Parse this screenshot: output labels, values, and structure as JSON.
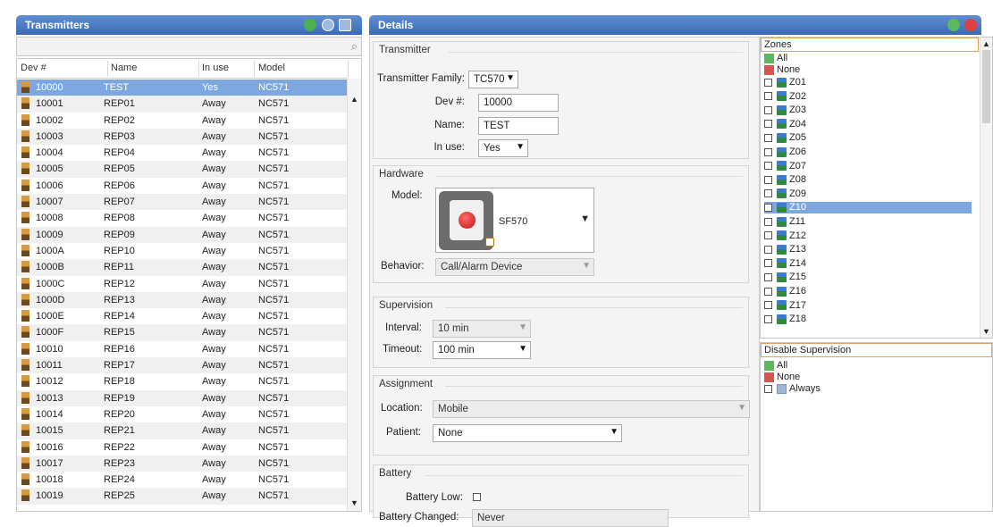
{
  "left_panel": {
    "title": "Transmitters",
    "columns": [
      "Dev #",
      "Name",
      "In use",
      "Model"
    ],
    "rows": [
      {
        "dev": "10000",
        "name": "TEST",
        "in_use": "Yes",
        "model": "NC571",
        "selected": true
      },
      {
        "dev": "10001",
        "name": "REP01",
        "in_use": "Away",
        "model": "NC571"
      },
      {
        "dev": "10002",
        "name": "REP02",
        "in_use": "Away",
        "model": "NC571"
      },
      {
        "dev": "10003",
        "name": "REP03",
        "in_use": "Away",
        "model": "NC571"
      },
      {
        "dev": "10004",
        "name": "REP04",
        "in_use": "Away",
        "model": "NC571"
      },
      {
        "dev": "10005",
        "name": "REP05",
        "in_use": "Away",
        "model": "NC571"
      },
      {
        "dev": "10006",
        "name": "REP06",
        "in_use": "Away",
        "model": "NC571"
      },
      {
        "dev": "10007",
        "name": "REP07",
        "in_use": "Away",
        "model": "NC571"
      },
      {
        "dev": "10008",
        "name": "REP08",
        "in_use": "Away",
        "model": "NC571"
      },
      {
        "dev": "10009",
        "name": "REP09",
        "in_use": "Away",
        "model": "NC571"
      },
      {
        "dev": "1000A",
        "name": "REP10",
        "in_use": "Away",
        "model": "NC571"
      },
      {
        "dev": "1000B",
        "name": "REP11",
        "in_use": "Away",
        "model": "NC571"
      },
      {
        "dev": "1000C",
        "name": "REP12",
        "in_use": "Away",
        "model": "NC571"
      },
      {
        "dev": "1000D",
        "name": "REP13",
        "in_use": "Away",
        "model": "NC571"
      },
      {
        "dev": "1000E",
        "name": "REP14",
        "in_use": "Away",
        "model": "NC571"
      },
      {
        "dev": "1000F",
        "name": "REP15",
        "in_use": "Away",
        "model": "NC571"
      },
      {
        "dev": "10010",
        "name": "REP16",
        "in_use": "Away",
        "model": "NC571"
      },
      {
        "dev": "10011",
        "name": "REP17",
        "in_use": "Away",
        "model": "NC571"
      },
      {
        "dev": "10012",
        "name": "REP18",
        "in_use": "Away",
        "model": "NC571"
      },
      {
        "dev": "10013",
        "name": "REP19",
        "in_use": "Away",
        "model": "NC571"
      },
      {
        "dev": "10014",
        "name": "REP20",
        "in_use": "Away",
        "model": "NC571"
      },
      {
        "dev": "10015",
        "name": "REP21",
        "in_use": "Away",
        "model": "NC571"
      },
      {
        "dev": "10016",
        "name": "REP22",
        "in_use": "Away",
        "model": "NC571"
      },
      {
        "dev": "10017",
        "name": "REP23",
        "in_use": "Away",
        "model": "NC571"
      },
      {
        "dev": "10018",
        "name": "REP24",
        "in_use": "Away",
        "model": "NC571"
      },
      {
        "dev": "10019",
        "name": "REP25",
        "in_use": "Away",
        "model": "NC571"
      }
    ],
    "header_icons": [
      "add-icon",
      "copy-icon",
      "delete-icon"
    ],
    "search_icon": "search-icon"
  },
  "details": {
    "title": "Details",
    "header_icons": [
      "confirm-icon",
      "cancel-icon"
    ],
    "transmitter": {
      "group_title": "Transmitter",
      "family_label": "Transmitter Family:",
      "family_value": "TC570",
      "dev_label": "Dev #:",
      "dev_value": "10000",
      "name_label": "Name:",
      "name_value": "TEST",
      "in_use_label": "In use:",
      "in_use_value": "Yes"
    },
    "hardware": {
      "group_title": "Hardware",
      "model_label": "Model:",
      "model_value": "SF570",
      "behavior_label": "Behavior:",
      "behavior_value": "Call/Alarm Device"
    },
    "supervision": {
      "group_title": "Supervision",
      "interval_label": "Interval:",
      "interval_value": "10 min",
      "timeout_label": "Timeout:",
      "timeout_value": "100 min"
    },
    "assignment": {
      "group_title": "Assignment",
      "location_label": "Location:",
      "location_value": "Mobile",
      "patient_label": "Patient:",
      "patient_value": "None"
    },
    "battery": {
      "group_title": "Battery",
      "low_label": "Battery Low:",
      "changed_label": "Battery Changed:",
      "changed_value": "Never"
    }
  },
  "zones": {
    "title": "Zones",
    "all_label": "All",
    "none_label": "None",
    "items": [
      {
        "label": "Z01",
        "checked": false
      },
      {
        "label": "Z02",
        "checked": false
      },
      {
        "label": "Z03",
        "checked": false
      },
      {
        "label": "Z04",
        "checked": false
      },
      {
        "label": "Z05",
        "checked": false
      },
      {
        "label": "Z06",
        "checked": false
      },
      {
        "label": "Z07",
        "checked": false
      },
      {
        "label": "Z08",
        "checked": false
      },
      {
        "label": "Z09",
        "checked": false
      },
      {
        "label": "Z10",
        "checked": true,
        "selected": true
      },
      {
        "label": "Z11",
        "checked": false
      },
      {
        "label": "Z12",
        "checked": false
      },
      {
        "label": "Z13",
        "checked": false
      },
      {
        "label": "Z14",
        "checked": false
      },
      {
        "label": "Z15",
        "checked": false
      },
      {
        "label": "Z16",
        "checked": false
      },
      {
        "label": "Z17",
        "checked": false
      },
      {
        "label": "Z18",
        "checked": false
      }
    ]
  },
  "disable_supervision": {
    "title": "Disable Supervision",
    "all_label": "All",
    "none_label": "None",
    "items": [
      {
        "label": "Always",
        "checked": false
      }
    ]
  },
  "colors": {
    "header_blue": "#3a6ab6",
    "selection_blue": "#7ea7e0"
  }
}
